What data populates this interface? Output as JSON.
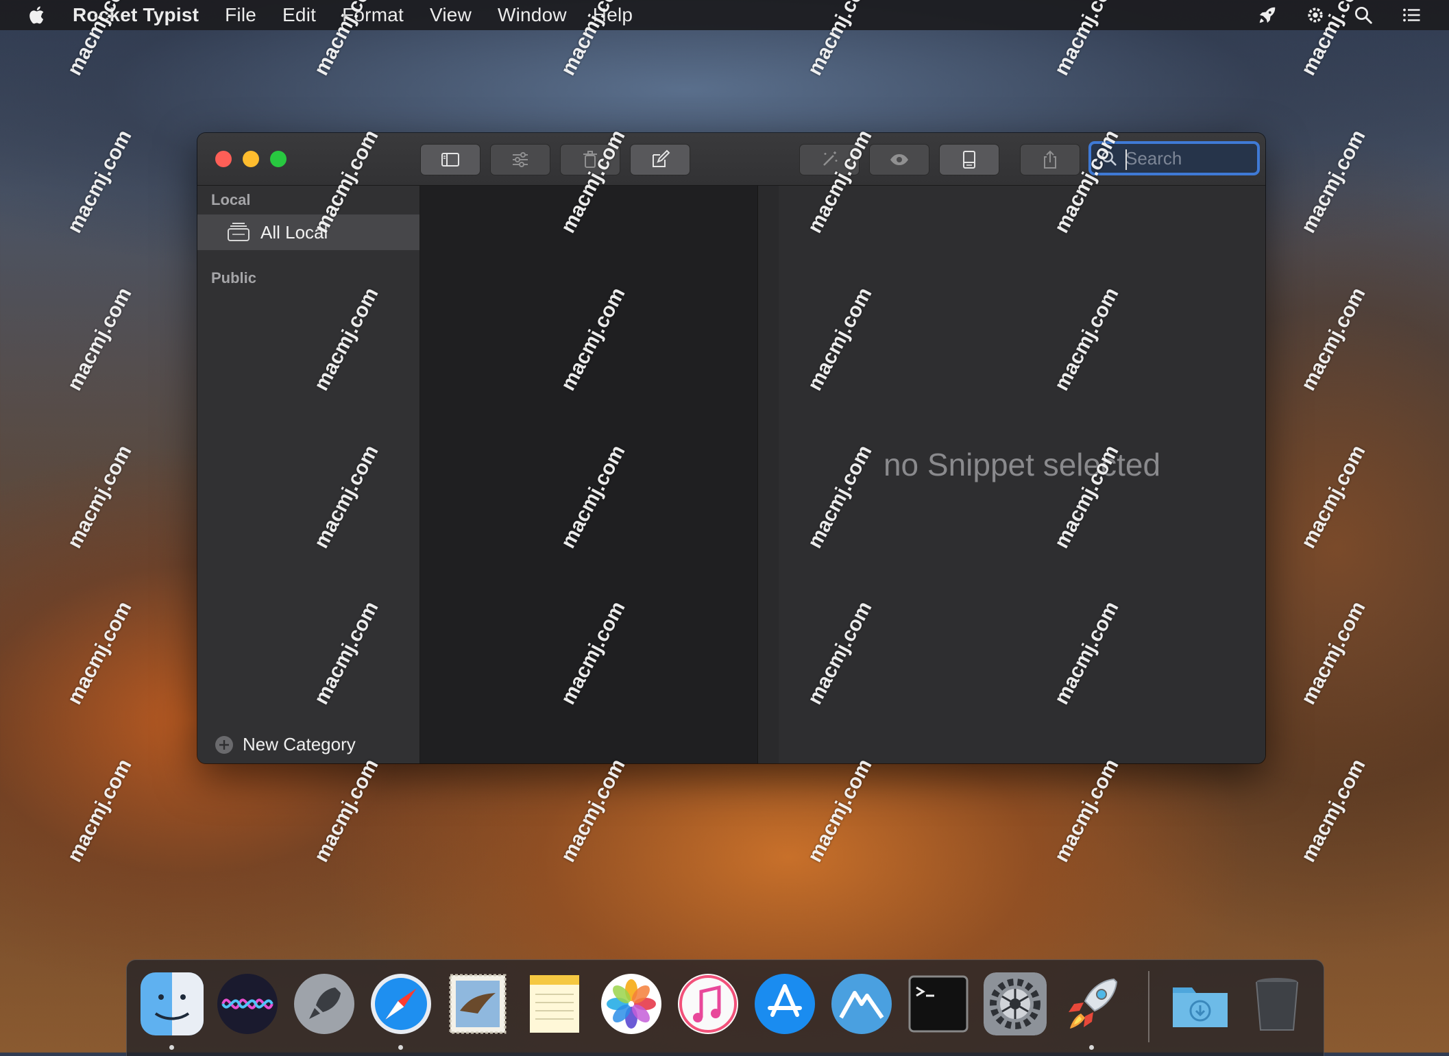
{
  "menubar": {
    "app_name": "Rocket Typist",
    "items": [
      "File",
      "Edit",
      "Format",
      "View",
      "Window",
      "Help"
    ]
  },
  "window": {
    "toolbar": {
      "buttons": [
        "sidebar-toggle-icon",
        "sliders-icon",
        "trash-icon",
        "compose-icon",
        "magic-wand-icon",
        "eye-icon",
        "panel-bottom-icon",
        "share-icon"
      ]
    },
    "search": {
      "placeholder": "Search"
    },
    "sidebar": {
      "local_label": "Local",
      "all_local_label": "All Local",
      "public_label": "Public",
      "new_category_label": "New Category"
    },
    "detail": {
      "empty_message": "no Snippet selected"
    }
  },
  "dock": {
    "apps": [
      "Finder",
      "Siri",
      "Launchpad",
      "Safari",
      "Mail",
      "Notes",
      "Photos",
      "iTunes",
      "App Store",
      "Instruments",
      "Terminal",
      "System Preferences",
      "Rocket Typist",
      "Downloads",
      "Trash"
    ]
  },
  "watermark": "macmj.com",
  "colors": {
    "close": "#fe5f57",
    "minimize": "#febc2e",
    "maximize": "#28c840",
    "search_focus": "#3f7ad6"
  }
}
